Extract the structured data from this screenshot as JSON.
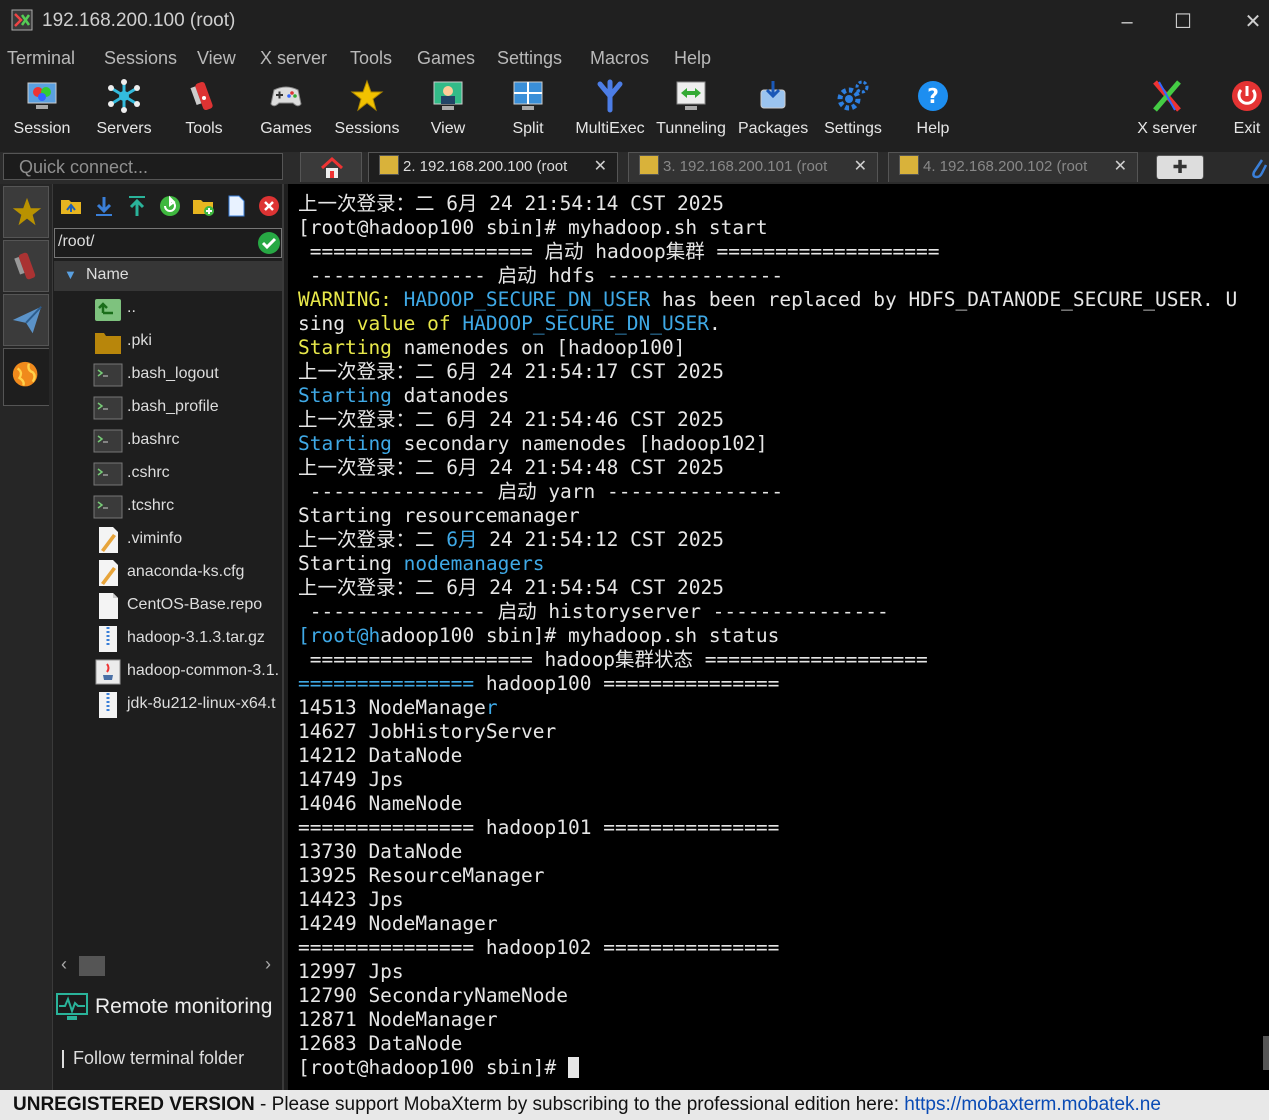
{
  "window": {
    "title": "192.168.200.100 (root)"
  },
  "menu": [
    "Terminal",
    "Sessions",
    "View",
    "X server",
    "Tools",
    "Games",
    "Settings",
    "Macros",
    "Help"
  ],
  "toolbar": {
    "session": "Session",
    "servers": "Servers",
    "tools": "Tools",
    "games": "Games",
    "sessions": "Sessions",
    "view": "View",
    "split": "Split",
    "multiexec": "MultiExec",
    "tunneling": "Tunneling",
    "packages": "Packages",
    "settings": "Settings",
    "help": "Help",
    "xserver": "X server",
    "exit": "Exit"
  },
  "quick_connect": {
    "placeholder": "Quick connect..."
  },
  "tabs": [
    {
      "label": "2. 192.168.200.100 (root"
    },
    {
      "label": "3. 192.168.200.101 (root"
    },
    {
      "label": "4. 192.168.200.102 (root"
    }
  ],
  "sftp": {
    "path": "/root/",
    "column": "Name",
    "files": [
      {
        "name": "..",
        "icon": "up-folder-icon"
      },
      {
        "name": ".pki",
        "icon": "folder-icon"
      },
      {
        "name": ".bash_logout",
        "icon": "terminal-file-icon"
      },
      {
        "name": ".bash_profile",
        "icon": "terminal-file-icon"
      },
      {
        "name": ".bashrc",
        "icon": "terminal-file-icon"
      },
      {
        "name": ".cshrc",
        "icon": "terminal-file-icon"
      },
      {
        "name": ".tcshrc",
        "icon": "terminal-file-icon"
      },
      {
        "name": ".viminfo",
        "icon": "edit-file-icon"
      },
      {
        "name": "anaconda-ks.cfg",
        "icon": "edit-file-icon"
      },
      {
        "name": "CentOS-Base.repo",
        "icon": "file-icon"
      },
      {
        "name": "hadoop-3.1.3.tar.gz",
        "icon": "archive-file-icon"
      },
      {
        "name": "hadoop-common-3.1.",
        "icon": "java-file-icon"
      },
      {
        "name": "jdk-8u212-linux-x64.t",
        "icon": "archive-file-icon"
      }
    ],
    "remote_monitoring": "Remote monitoring",
    "follow_terminal": "Follow terminal folder"
  },
  "terminal": {
    "l01": "上一次登录：二 6月 24 21:54:14 CST 2025",
    "l02": "[root@hadoop100 sbin]# myhadoop.sh start",
    "l03": " =================== 启动 hadoop集群 ===================",
    "l04": " --------------- 启动 hdfs ---------------",
    "l05a": "WARNING: ",
    "l05b": "HADOOP_SECURE_DN_USER",
    "l05c": " has been replaced by HDFS_DATANODE_SECURE_USER. U",
    "l06a": "sing ",
    "l06b": "value",
    "l06c": " ",
    "l06d": "of",
    "l06e": " ",
    "l06f": "HADOOP_SECURE_DN_USER",
    "l06g": ".",
    "l07a": "Starting",
    "l07b": " namenodes on [hadoop100]",
    "l08": "上一次登录：二 6月 24 21:54:17 CST 2025",
    "l09a": "Starting",
    "l09b": " datanodes",
    "l10": "上一次登录：二 6月 24 21:54:46 CST 2025",
    "l11a": "Starting",
    "l11b": " secondary namenodes [hadoop102]",
    "l12": "上一次登录：二 6月 24 21:54:48 CST 2025",
    "l13": " --------------- 启动 yarn ---------------",
    "l14": "Starting resourcemanager",
    "l15a": "上一次登录：二 ",
    "l15b": "6月",
    "l15c": " 24 21:54:12 CST 2025",
    "l16a": "Starting ",
    "l16b": "nodemanagers",
    "l17": "上一次登录：二 6月 24 21:54:54 CST 2025",
    "l18": " --------------- 启动 historyserver ---------------",
    "l19a": "[root@h",
    "l19b": "adoop100 sbin]# myhadoop.sh status",
    "l20": " =================== hadoop集群状态 ===================",
    "l21a": "===============",
    "l21b": " hadoop100 ===============",
    "l22a": "14513 NodeManage",
    "l22b": "r",
    "l23": "14627 JobHistoryServer",
    "l24": "14212 DataNode",
    "l25": "14749 Jps",
    "l26": "14046 NameNode",
    "l27": "=============== hadoop101 ===============",
    "l28": "13730 DataNode",
    "l29": "13925 ResourceManager",
    "l30": "14423 Jps",
    "l31": "14249 NodeManager",
    "l32": "=============== hadoop102 ===============",
    "l33": "12997 Jps",
    "l34": "12790 SecondaryNameNode",
    "l35": "12871 NodeManager",
    "l36": "12683 DataNode",
    "l37": "[root@hadoop100 sbin]# "
  },
  "status": {
    "unregistered": "UNREGISTERED VERSION",
    "sep": " - ",
    "message": "Please support MobaXterm by subscribing to the professional edition here: ",
    "link": "https://mobaxterm.mobatek.ne"
  }
}
